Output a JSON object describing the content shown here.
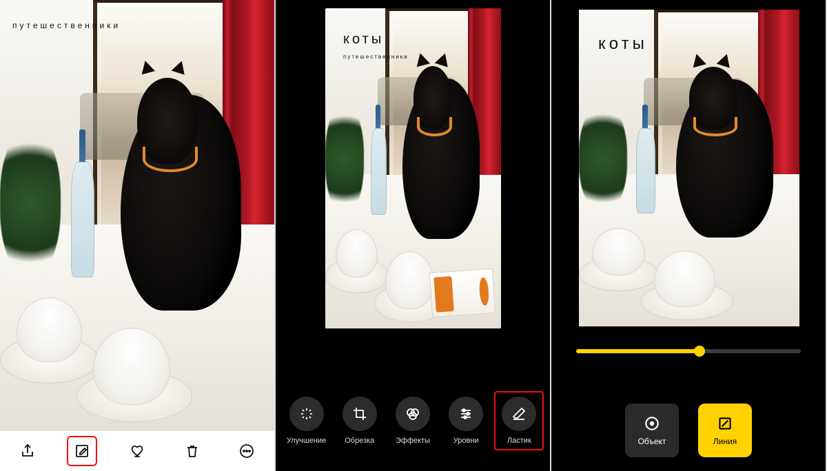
{
  "panel1": {
    "caption_small": "путешественники",
    "toolbar": {
      "share": "share-icon",
      "edit": "edit-icon",
      "favorite": "heart-icon",
      "delete": "trash-icon",
      "more": "more-icon"
    }
  },
  "panel2": {
    "caption_big": "коты",
    "caption_small": "путешественники",
    "tools": [
      {
        "key": "enhance",
        "label": "Улучшение"
      },
      {
        "key": "crop",
        "label": "Обрезка"
      },
      {
        "key": "effects",
        "label": "Эффекты"
      },
      {
        "key": "levels",
        "label": "Уровни"
      },
      {
        "key": "eraser",
        "label": "Ластик"
      }
    ]
  },
  "panel3": {
    "caption_big": "коты",
    "slider_percent": 55,
    "modes": {
      "object": "Объект",
      "line": "Линия"
    }
  },
  "colors": {
    "accent_yellow": "#ffd200",
    "highlight_red": "#e11",
    "dark_btn": "#2b2b2b"
  }
}
